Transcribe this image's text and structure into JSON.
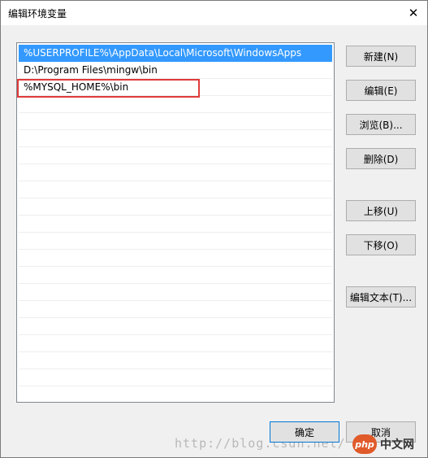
{
  "window": {
    "title": "编辑环境变量",
    "close_glyph": "✕"
  },
  "path_list": {
    "items": [
      "%USERPROFILE%\\AppData\\Local\\Microsoft\\WindowsApps",
      "D:\\Program Files\\mingw\\bin",
      "%MYSQL_HOME%\\bin"
    ],
    "selected_index": 0,
    "highlighted_index": 2,
    "highlight_color": "#e03a3a",
    "selection_color": "#3399ff"
  },
  "buttons": {
    "new": "新建(N)",
    "edit": "编辑(E)",
    "browse": "浏览(B)...",
    "delete": "删除(D)",
    "move_up": "上移(U)",
    "move_down": "下移(O)",
    "edit_text": "编辑文本(T)...",
    "ok": "确定",
    "cancel": "取消"
  },
  "watermark": {
    "text": "http://blog.csdn.net/"
  },
  "logo": {
    "badge": "php",
    "text": "中文网"
  }
}
